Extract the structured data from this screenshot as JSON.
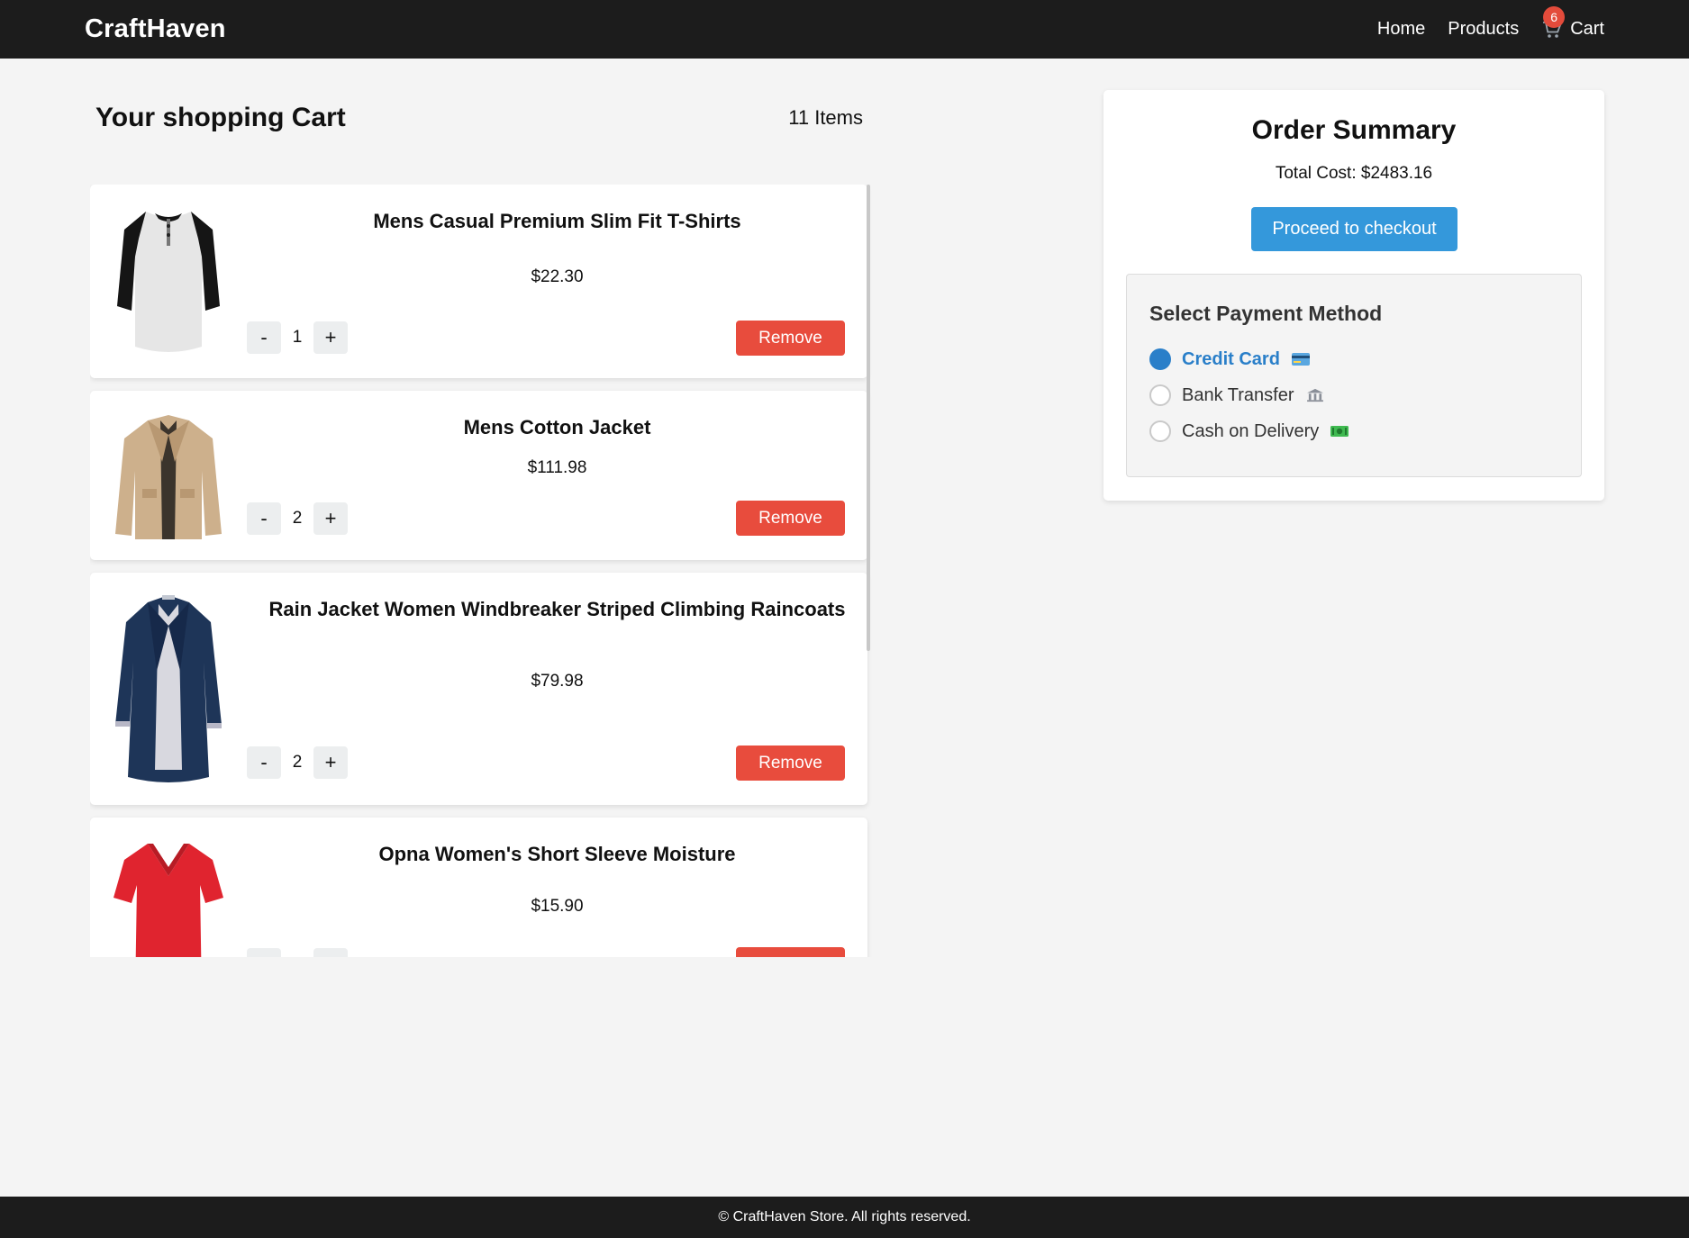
{
  "nav": {
    "brand": "CraftHaven",
    "links": {
      "home": "Home",
      "products": "Products",
      "cart": "Cart"
    },
    "cart_badge": "6",
    "cart_icon": "shopping-cart-icon"
  },
  "cart": {
    "title": "Your shopping Cart",
    "count_label": "11 Items",
    "remove_label": "Remove",
    "decrement_label": "-",
    "increment_label": "+",
    "items": [
      {
        "name": "Mens Casual Premium Slim Fit T-Shirts",
        "price": "$22.30",
        "quantity": "1",
        "image": "raglan-tshirt"
      },
      {
        "name": "Mens Cotton Jacket",
        "price": "$111.98",
        "quantity": "2",
        "image": "beige-jacket"
      },
      {
        "name": "Rain Jacket Women Windbreaker Striped Climbing Raincoats",
        "price": "$79.98",
        "quantity": "2",
        "image": "navy-raincoat"
      },
      {
        "name": "Opna Women's Short Sleeve Moisture",
        "price": "$15.90",
        "quantity": "",
        "image": "red-vneck-tshirt"
      }
    ]
  },
  "summary": {
    "title": "Order Summary",
    "total": "Total Cost: $2483.16",
    "checkout_label": "Proceed to checkout",
    "payment_title": "Select Payment Method",
    "payment_options": [
      {
        "label": "Credit Card",
        "icon": "credit-card-icon",
        "selected": true
      },
      {
        "label": "Bank Transfer",
        "icon": "bank-icon",
        "selected": false
      },
      {
        "label": "Cash on Delivery",
        "icon": "cash-icon",
        "selected": false
      }
    ]
  },
  "footer": {
    "text": "© CraftHaven Store. All rights reserved."
  },
  "colors": {
    "nav_bg": "#1c1c1c",
    "remove": "#e84c3d",
    "checkout": "#3498db",
    "selected": "#2a7fc9",
    "badge": "#e34b3b"
  }
}
